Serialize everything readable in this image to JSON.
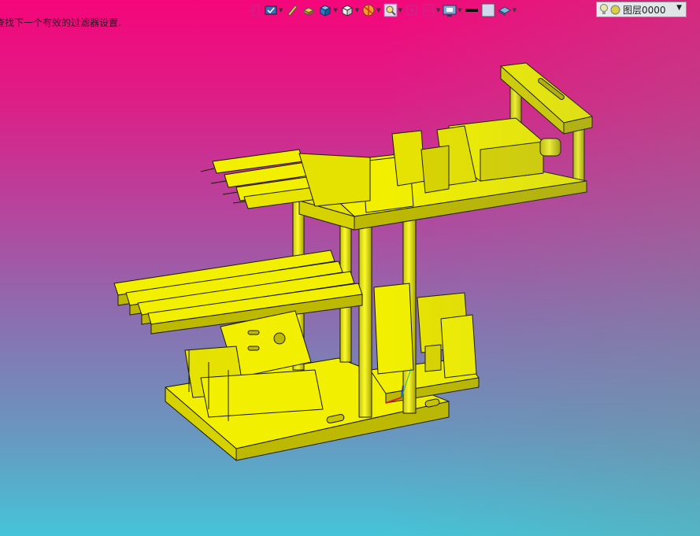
{
  "status_message": "查找下一个有效的过滤器设置.",
  "toolbar": {
    "buttons": [
      {
        "icon": "exit-sketch-icon",
        "dropdown": false
      },
      {
        "icon": "dimension-icon",
        "dropdown": true
      },
      {
        "icon": "pencil-icon",
        "dropdown": false
      },
      {
        "icon": "extrude-icon",
        "dropdown": false
      },
      {
        "icon": "cube-blue-icon",
        "dropdown": true
      },
      {
        "icon": "view-orientation-icon",
        "dropdown": true
      },
      {
        "icon": "section-view-icon",
        "dropdown": true
      },
      {
        "icon": "zoom-area-icon",
        "dropdown": true
      },
      {
        "icon": "zoom-fit-icon",
        "dropdown": false
      },
      {
        "icon": "hide-show-icon",
        "dropdown": true
      },
      {
        "icon": "display-style-icon",
        "dropdown": true
      },
      {
        "icon": "line-color-icon",
        "dropdown": false
      },
      {
        "icon": "fill-color-icon",
        "dropdown": false
      },
      {
        "icon": "appearance-icon",
        "dropdown": true
      }
    ]
  },
  "layer": {
    "value": "图层0000"
  },
  "colors": {
    "part_yellow": "#f2f000",
    "part_shadow": "#b8b400",
    "edge": "#1a1a00",
    "bg_top": "#f5067a",
    "bg_bottom": "#45c4d8"
  }
}
